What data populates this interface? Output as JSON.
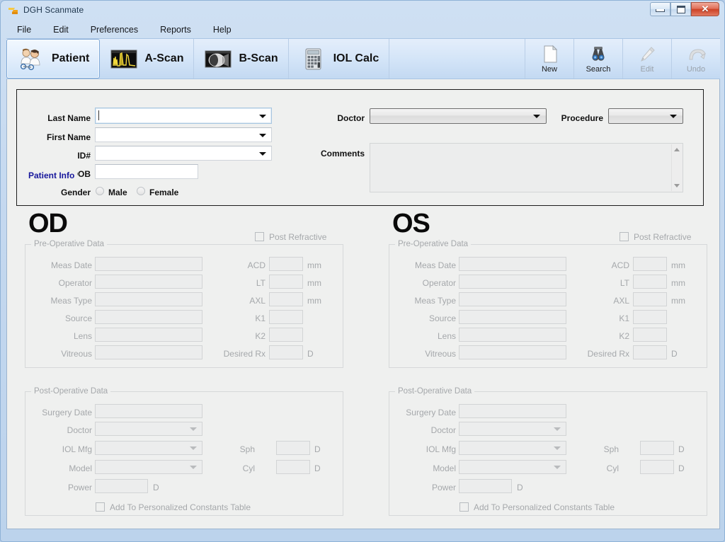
{
  "window": {
    "title": "DGH Scanmate",
    "icon": "app-icon",
    "controls": {
      "minimize": "Minimize",
      "maximize": "Maximize",
      "close": "Close"
    }
  },
  "menu": {
    "items": [
      {
        "label": "File"
      },
      {
        "label": "Edit"
      },
      {
        "label": "Preferences"
      },
      {
        "label": "Reports"
      },
      {
        "label": "Help"
      }
    ]
  },
  "toolbar": {
    "main_buttons": [
      {
        "label": "Patient",
        "icon": "patient-icon",
        "active": true
      },
      {
        "label": "A-Scan",
        "icon": "a-scan-icon",
        "active": false
      },
      {
        "label": "B-Scan",
        "icon": "b-scan-icon",
        "active": false
      },
      {
        "label": "IOL Calc",
        "icon": "calculator-icon",
        "active": false
      }
    ],
    "action_buttons": [
      {
        "label": "New",
        "icon": "new-document-icon",
        "enabled": true
      },
      {
        "label": "Search",
        "icon": "binoculars-icon",
        "enabled": true
      },
      {
        "label": "Edit",
        "icon": "pencil-icon",
        "enabled": false
      },
      {
        "label": "Undo",
        "icon": "undo-arrow-icon",
        "enabled": false
      }
    ]
  },
  "patient_info": {
    "legend": "Patient Info",
    "last_name": {
      "label": "Last Name",
      "value": "",
      "focused": true
    },
    "first_name": {
      "label": "First Name",
      "value": ""
    },
    "id": {
      "label": "ID#",
      "value": ""
    },
    "dob": {
      "label": "DOB",
      "value": ""
    },
    "gender": {
      "label": "Gender",
      "options": [
        {
          "label": "Male",
          "selected": false
        },
        {
          "label": "Female",
          "selected": false
        }
      ]
    },
    "doctor": {
      "label": "Doctor",
      "value": ""
    },
    "procedure": {
      "label": "Procedure",
      "value": ""
    },
    "comments": {
      "label": "Comments",
      "value": ""
    }
  },
  "eyes": [
    {
      "id": "od",
      "title": "OD",
      "post_refractive": {
        "label": "Post Refractive",
        "checked": false
      },
      "pre_op": {
        "legend": "Pre-Operative Data",
        "left_fields": [
          {
            "label": "Meas Date",
            "value": ""
          },
          {
            "label": "Operator",
            "value": ""
          },
          {
            "label": "Meas Type",
            "value": ""
          },
          {
            "label": "Source",
            "value": ""
          },
          {
            "label": "Lens",
            "value": ""
          },
          {
            "label": "Vitreous",
            "value": ""
          }
        ],
        "right_fields": [
          {
            "label": "ACD",
            "value": "",
            "unit": "mm"
          },
          {
            "label": "LT",
            "value": "",
            "unit": "mm"
          },
          {
            "label": "AXL",
            "value": "",
            "unit": "mm"
          },
          {
            "label": "K1",
            "value": "",
            "unit": ""
          },
          {
            "label": "K2",
            "value": "",
            "unit": ""
          },
          {
            "label": "Desired Rx",
            "value": "",
            "unit": "D"
          }
        ]
      },
      "post_op": {
        "legend": "Post-Operative Data",
        "surgery_date": {
          "label": "Surgery Date",
          "value": ""
        },
        "doctor": {
          "label": "Doctor",
          "value": ""
        },
        "iol_mfg": {
          "label": "IOL Mfg",
          "value": ""
        },
        "model": {
          "label": "Model",
          "value": ""
        },
        "power": {
          "label": "Power",
          "value": "",
          "unit": "D"
        },
        "sph": {
          "label": "Sph",
          "value": "",
          "unit": "D"
        },
        "cyl": {
          "label": "Cyl",
          "value": "",
          "unit": "D"
        },
        "add_constants": {
          "label": "Add To Personalized Constants Table",
          "checked": false
        }
      }
    },
    {
      "id": "os",
      "title": "OS",
      "post_refractive": {
        "label": "Post Refractive",
        "checked": false
      },
      "pre_op": {
        "legend": "Pre-Operative Data",
        "left_fields": [
          {
            "label": "Meas Date",
            "value": ""
          },
          {
            "label": "Operator",
            "value": ""
          },
          {
            "label": "Meas Type",
            "value": ""
          },
          {
            "label": "Source",
            "value": ""
          },
          {
            "label": "Lens",
            "value": ""
          },
          {
            "label": "Vitreous",
            "value": ""
          }
        ],
        "right_fields": [
          {
            "label": "ACD",
            "value": "",
            "unit": "mm"
          },
          {
            "label": "LT",
            "value": "",
            "unit": "mm"
          },
          {
            "label": "AXL",
            "value": "",
            "unit": "mm"
          },
          {
            "label": "K1",
            "value": "",
            "unit": ""
          },
          {
            "label": "K2",
            "value": "",
            "unit": ""
          },
          {
            "label": "Desired Rx",
            "value": "",
            "unit": "D"
          }
        ]
      },
      "post_op": {
        "legend": "Post-Operative Data",
        "surgery_date": {
          "label": "Surgery Date",
          "value": ""
        },
        "doctor": {
          "label": "Doctor",
          "value": ""
        },
        "iol_mfg": {
          "label": "IOL Mfg",
          "value": ""
        },
        "model": {
          "label": "Model",
          "value": ""
        },
        "power": {
          "label": "Power",
          "value": "",
          "unit": "D"
        },
        "sph": {
          "label": "Sph",
          "value": "",
          "unit": "D"
        },
        "cyl": {
          "label": "Cyl",
          "value": "",
          "unit": "D"
        },
        "add_constants": {
          "label": "Add To Personalized Constants Table",
          "checked": false
        }
      }
    }
  ],
  "colors": {
    "title_bar": "#c4d8ef",
    "toolbar": "#d4e5f8",
    "client_bg": "#eff0ef",
    "legend_accent": "#17179c",
    "disabled_text": "#a5a8ab",
    "close_button": "#cd4226"
  }
}
